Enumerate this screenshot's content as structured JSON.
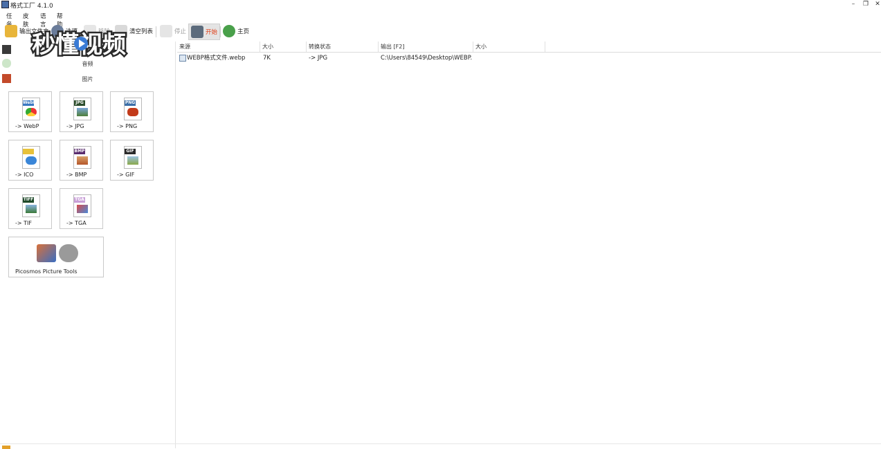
{
  "window": {
    "title": "格式工厂 4.1.0"
  },
  "menu": [
    "任务",
    "皮肤",
    "语言",
    "帮助"
  ],
  "toolbar": {
    "output_folder": "输出文件夹",
    "options": "选项",
    "remove": "移除",
    "clear_list": "清空列表",
    "stop": "停止",
    "start": "开始",
    "home": "主页"
  },
  "watermark": {
    "text": "秒懂视频",
    "brand_color": "#3a7bd5"
  },
  "left_panel": {
    "categories": {
      "audio": "音频",
      "picture": "图片"
    },
    "tiles": [
      {
        "label": "-> WebP",
        "tag": "WebP",
        "tag_color": "#3a78c2"
      },
      {
        "label": "-> JPG",
        "tag": "JPG",
        "tag_color": "#2c4d2c"
      },
      {
        "label": "-> PNG",
        "tag": "PNG",
        "tag_color": "#3a6ea8"
      },
      {
        "label": "-> ICO",
        "tag": "",
        "tag_color": "#e8c23a"
      },
      {
        "label": "-> BMP",
        "tag": "BMP",
        "tag_color": "#5a2d6e"
      },
      {
        "label": "-> GIF",
        "tag": "GIF",
        "tag_color": "#2a2a2a"
      },
      {
        "label": "-> TIF",
        "tag": "TIFF",
        "tag_color": "#1f4a2a"
      },
      {
        "label": "-> TGA",
        "tag": "TGA",
        "tag_color": "#c9a0d8"
      }
    ],
    "tools_tile": {
      "label": "Picosmos Picture Tools"
    }
  },
  "list": {
    "columns": [
      "来源",
      "大小",
      "转换状态",
      "输出 [F2]",
      "大小"
    ],
    "rows": [
      {
        "source": "WEBP格式文件.webp",
        "size": "7K",
        "status": "-> JPG",
        "output": "C:\\Users\\84549\\Desktop\\WEBP...",
        "out_size": ""
      }
    ]
  },
  "colors": {
    "start_text": "#e03a12",
    "disabled_text": "#9a9a9a"
  }
}
